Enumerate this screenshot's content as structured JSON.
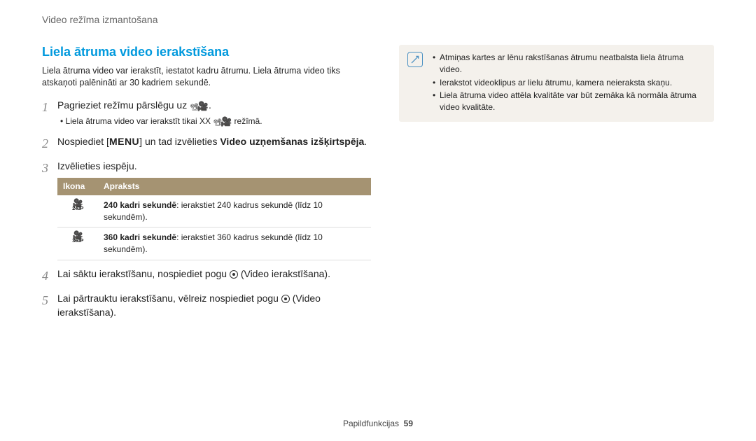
{
  "header": {
    "breadcrumb": "Video režīma izmantošana"
  },
  "section": {
    "title": "Liela ātruma video ierakstīšana",
    "intro": "Liela ātruma video var ierakstīt, iestatot kadru ātrumu. Liela ātruma video tiks atskaņoti palēnināti ar 30 kadriem sekundē."
  },
  "steps": {
    "s1": {
      "text_a": "Pagrieziet režīmu pārslēgu uz ",
      "text_b": ".",
      "sub_a": "Liela ātruma video var ierakstīt tikai XX ",
      "sub_b": " režīmā."
    },
    "s2": {
      "text_a": "Nospiediet [",
      "menu": "MENU",
      "text_b": "] un tad izvēlieties ",
      "bold": "Video uzņemšanas izšķirtspēja",
      "text_c": "."
    },
    "s3": {
      "text": "Izvēlieties iespēju."
    },
    "s4": {
      "text_a": "Lai sāktu ierakstīšanu, nospiediet pogu ",
      "text_b": " (Video ierakstīšana)."
    },
    "s5": {
      "text_a": "Lai pārtrauktu ierakstīšanu, vēlreiz nospiediet pogu ",
      "text_b": " (Video ierakstīšana)."
    }
  },
  "table": {
    "h_icon": "Ikona",
    "h_desc": "Apraksts",
    "rows": [
      {
        "icon_fps": "240P",
        "desc_bold": "240 kadri sekundē",
        "desc_rest": ": ierakstiet 240 kadrus sekundē (līdz 10 sekundēm)."
      },
      {
        "icon_fps": "360P",
        "desc_bold": "360 kadri sekundē",
        "desc_rest": ": ierakstiet 360 kadrus sekundē (līdz 10 sekundēm)."
      }
    ]
  },
  "notes": {
    "items": [
      "Atmiņas kartes ar lēnu rakstīšanas ātrumu neatbalsta liela ātruma video.",
      "Ierakstot videoklipus ar lielu ātrumu, kamera neieraksta skaņu.",
      "Liela ātruma video attēla kvalitāte var būt zemāka kā normāla ātruma video kvalitāte."
    ]
  },
  "footer": {
    "label": "Papildfunkcijas",
    "page": "59"
  }
}
